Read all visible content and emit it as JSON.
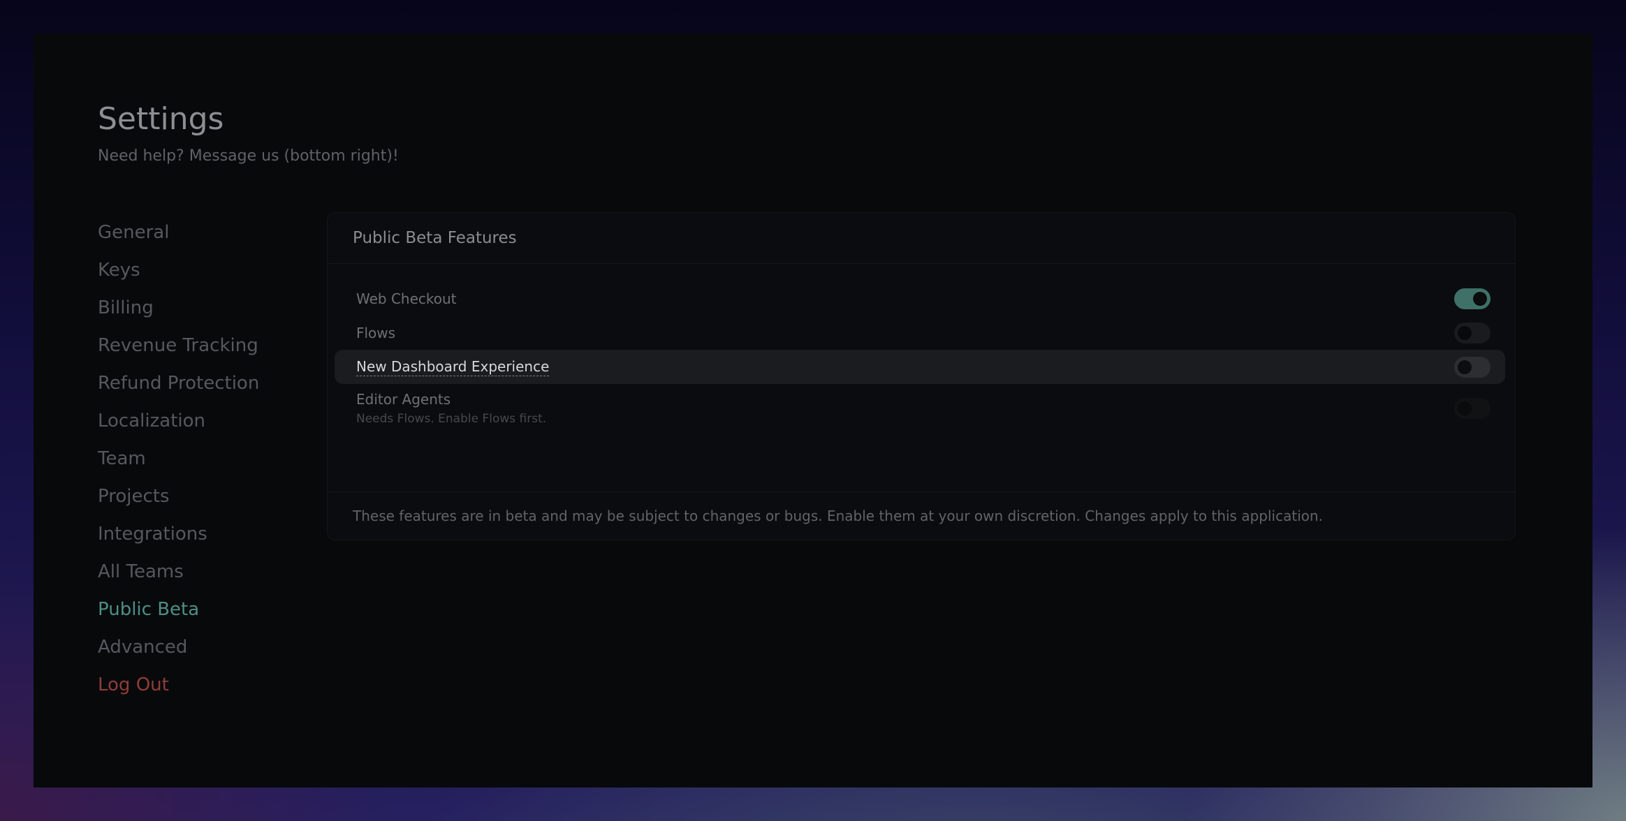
{
  "header": {
    "title": "Settings",
    "subtitle": "Need help? Message us (bottom right)!"
  },
  "sidebar": {
    "items": [
      {
        "label": "General",
        "state": "default"
      },
      {
        "label": "Keys",
        "state": "default"
      },
      {
        "label": "Billing",
        "state": "default"
      },
      {
        "label": "Revenue Tracking",
        "state": "default"
      },
      {
        "label": "Refund Protection",
        "state": "default"
      },
      {
        "label": "Localization",
        "state": "default"
      },
      {
        "label": "Team",
        "state": "default"
      },
      {
        "label": "Projects",
        "state": "default"
      },
      {
        "label": "Integrations",
        "state": "default"
      },
      {
        "label": "All Teams",
        "state": "default"
      },
      {
        "label": "Public Beta",
        "state": "active"
      },
      {
        "label": "Advanced",
        "state": "default"
      },
      {
        "label": "Log Out",
        "state": "danger"
      }
    ]
  },
  "card": {
    "title": "Public Beta Features",
    "features": [
      {
        "label": "Web Checkout",
        "enabled": true
      },
      {
        "label": "Flows",
        "enabled": false
      },
      {
        "label": "New Dashboard Experience",
        "enabled": false,
        "hovered": true
      },
      {
        "label": "Editor Agents",
        "enabled": false,
        "disabled": true,
        "note": "Needs Flows. Enable Flows first."
      }
    ],
    "footer": "These features are in beta and may be subject to changes or bugs. Enable them at your own discretion. Changes apply to this application."
  },
  "colors": {
    "accent": "#4f8e86",
    "toggle_on": "#3f7168",
    "danger": "#8e3e3a",
    "window_bg": "#08090b"
  }
}
